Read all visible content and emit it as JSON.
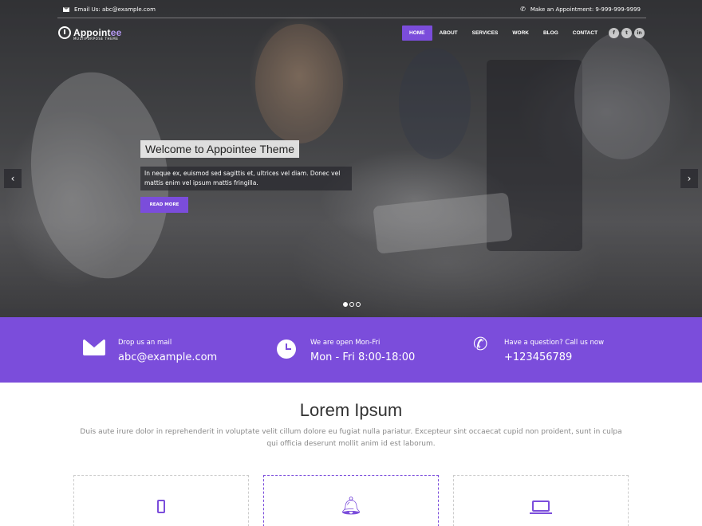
{
  "topbar": {
    "email_text": "Email Us: abc@example.com",
    "appointment_text": "Make an Appointment: 9-999-999-9999"
  },
  "brand": {
    "name_main": "Appoint",
    "name_accent": "ee",
    "tagline": "MULTIPURPOSE THEME"
  },
  "nav": {
    "items": [
      {
        "label": "HOME",
        "active": true
      },
      {
        "label": "ABOUT"
      },
      {
        "label": "SERVICES"
      },
      {
        "label": "WORK"
      },
      {
        "label": "BLOG"
      },
      {
        "label": "CONTACT"
      }
    ]
  },
  "social": {
    "icons": [
      "facebook-icon",
      "twitter-icon",
      "linkedin-icon"
    ],
    "glyphs": [
      "f",
      "t",
      "in"
    ]
  },
  "slider": {
    "title": "Welcome to Appointee Theme",
    "text": "In neque ex, euismod sed sagittis et, ultrices vel diam. Donec vel mattis enim vel ipsum mattis fringilla.",
    "button_label": "READ MORE",
    "prev_glyph": "‹",
    "next_glyph": "›",
    "slide_count": 3,
    "active_slide": 1
  },
  "info": {
    "mail_label": "Drop us an mail",
    "mail_value": "abc@example.com",
    "hours_label": "We are open Mon-Fri",
    "hours_value": "Mon - Fri 8:00-18:00",
    "call_label": "Have a question? Call us now",
    "call_value": "+123456789"
  },
  "section": {
    "title": "Lorem Ipsum",
    "text": "Duis aute irure dolor in reprehenderit in voluptate velit cillum dolore eu fugiat nulla pariatur. Excepteur sint occaecat cupid non proident, sunt in culpa qui officia deserunt mollit anim id est laborum."
  },
  "features": {
    "icons": [
      "mobile-icon",
      "bell-icon",
      "laptop-icon"
    ]
  },
  "colors": {
    "accent": "#7b4ddb",
    "text_dark": "#333333",
    "text_muted": "#888888"
  }
}
